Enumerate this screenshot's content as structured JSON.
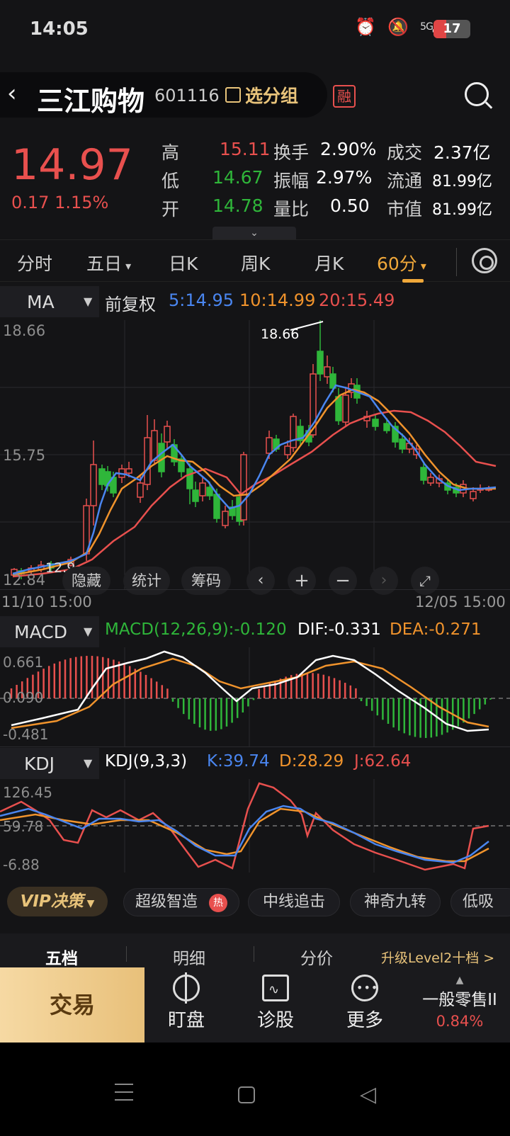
{
  "status_bar": {
    "time": "14:05",
    "network": "5G",
    "battery": "17"
  },
  "header": {
    "back_icon": "chevron-left-icon",
    "stock_name": "三江购物",
    "stock_code": "601116",
    "group_button": "选分组",
    "margin_badge": "融",
    "search_icon": "search-icon"
  },
  "quote": {
    "price": "14.97",
    "change": "0.17 1.15%",
    "high_label": "高",
    "high": "15.11",
    "low_label": "低",
    "low": "14.67",
    "open_label": "开",
    "open": "14.78",
    "turnover_label": "换手",
    "turnover": "2.90%",
    "amplitude_label": "振幅",
    "amplitude": "2.97%",
    "volume_ratio_label": "量比",
    "volume_ratio": "0.50",
    "deal_label": "成交",
    "deal": "2.37亿",
    "float_label": "流通",
    "float_cap": "81.99亿",
    "mktcap_label": "市值",
    "mktcap": "81.99亿"
  },
  "tabs": [
    "分时",
    "五日",
    "日K",
    "周K",
    "月K",
    "60分"
  ],
  "active_tab": "60分",
  "ma_header": {
    "indicator": "MA",
    "adjust": "前复权",
    "ma5": "5:14.95",
    "ma10": "10:14.99",
    "ma20": "20:15.49"
  },
  "main_chart": {
    "y_max": "18.66",
    "y_mid": "15.75",
    "y_min": "12.84",
    "peak_label": "18.66",
    "low_label": "12.9",
    "date_start": "11/10 15:00",
    "date_end": "12/05 15:00",
    "overlay": [
      "隐藏",
      "统计",
      "筹码"
    ]
  },
  "macd": {
    "name": "MACD",
    "params": "MACD(12,26,9):-0.120",
    "dif": "DIF:-0.331",
    "dea": "DEA:-0.271",
    "y_max": "0.661",
    "y_mid": "0.090",
    "y_min": "-0.481"
  },
  "kdj": {
    "name": "KDJ",
    "params": "KDJ(9,3,3)",
    "k": "K:39.74",
    "d": "D:28.29",
    "j": "J:62.64",
    "y_max": "126.45",
    "y_mid": "59.78",
    "y_min": "-6.88"
  },
  "strategies": {
    "vip": "VIP决策",
    "items": [
      "超级智造",
      "中线追击",
      "神奇九转",
      "低吸"
    ],
    "hot_badge": "热"
  },
  "level_tabs": [
    "五档",
    "明细",
    "分价"
  ],
  "level_upgrade": "升级Level2十档 >",
  "actions": {
    "trade": "交易",
    "watch": "盯盘",
    "diagnose": "诊股",
    "more": "更多",
    "industry": "一般零售II",
    "industry_change": "0.84%"
  },
  "colors": {
    "up": "#e8504e",
    "down": "#2fb63a",
    "ma5": "#4a86f0",
    "ma10": "#f0932c",
    "ma20": "#e8504e",
    "accent": "#e8c37a"
  }
}
